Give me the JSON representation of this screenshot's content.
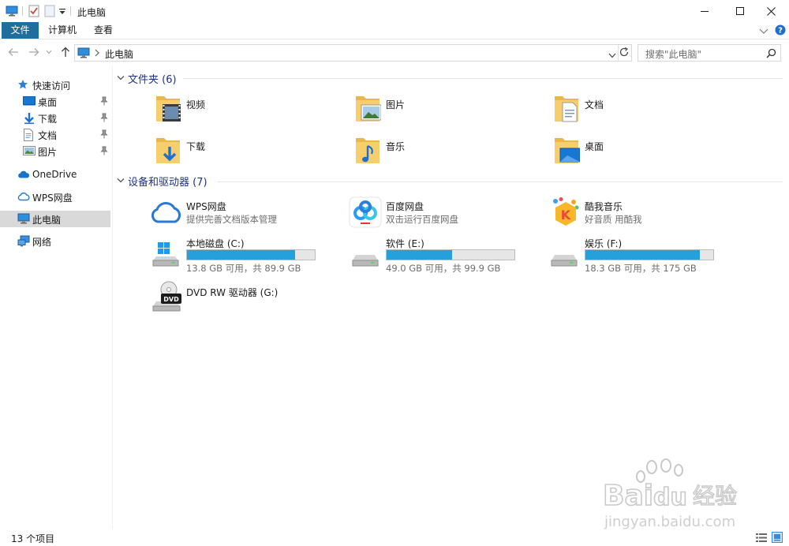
{
  "window": {
    "title": "此电脑"
  },
  "ribbon": {
    "tabs": [
      "文件",
      "计算机",
      "查看"
    ]
  },
  "address": {
    "path": "此电脑",
    "search_placeholder": "搜索\"此电脑\""
  },
  "nav_pane": {
    "quick_access": "快速访问",
    "quick_items": [
      "桌面",
      "下载",
      "文档",
      "图片"
    ],
    "onedrive": "OneDrive",
    "wps": "WPS网盘",
    "this_pc": "此电脑",
    "network": "网络"
  },
  "content": {
    "folders_header": "文件夹 (6)",
    "folders": [
      "视频",
      "图片",
      "文档",
      "下载",
      "音乐",
      "桌面"
    ],
    "devices_header": "设备和驱动器 (7)",
    "apps": [
      {
        "name": "WPS网盘",
        "sub": "提供完善文档版本管理"
      },
      {
        "name": "百度网盘",
        "sub": "双击运行百度网盘"
      },
      {
        "name": "酷我音乐",
        "sub": "好音质 用酷我"
      }
    ],
    "drives": [
      {
        "name": "本地磁盘 (C:)",
        "sub": "13.8 GB 可用，共 89.9 GB",
        "used_fraction": 0.846
      },
      {
        "name": "软件 (E:)",
        "sub": "49.0 GB 可用，共 99.9 GB",
        "used_fraction": 0.51
      },
      {
        "name": "娱乐 (F:)",
        "sub": "18.3 GB 可用，共 175 GB",
        "used_fraction": 0.895
      }
    ],
    "dvd": {
      "name": "DVD RW 驱动器 (G:)",
      "badge": "DVD"
    }
  },
  "status": {
    "count": "13 个项目"
  },
  "watermark": {
    "brand_a": "Bai",
    "brand_b": "du",
    "brand_c": "经验",
    "url": "jingyan.baidu.com"
  },
  "colors": {
    "accent": "#1f6f9e",
    "header_text": "#1e3287",
    "drive_fill": "#26a0da",
    "folder": "#f4c55b"
  }
}
